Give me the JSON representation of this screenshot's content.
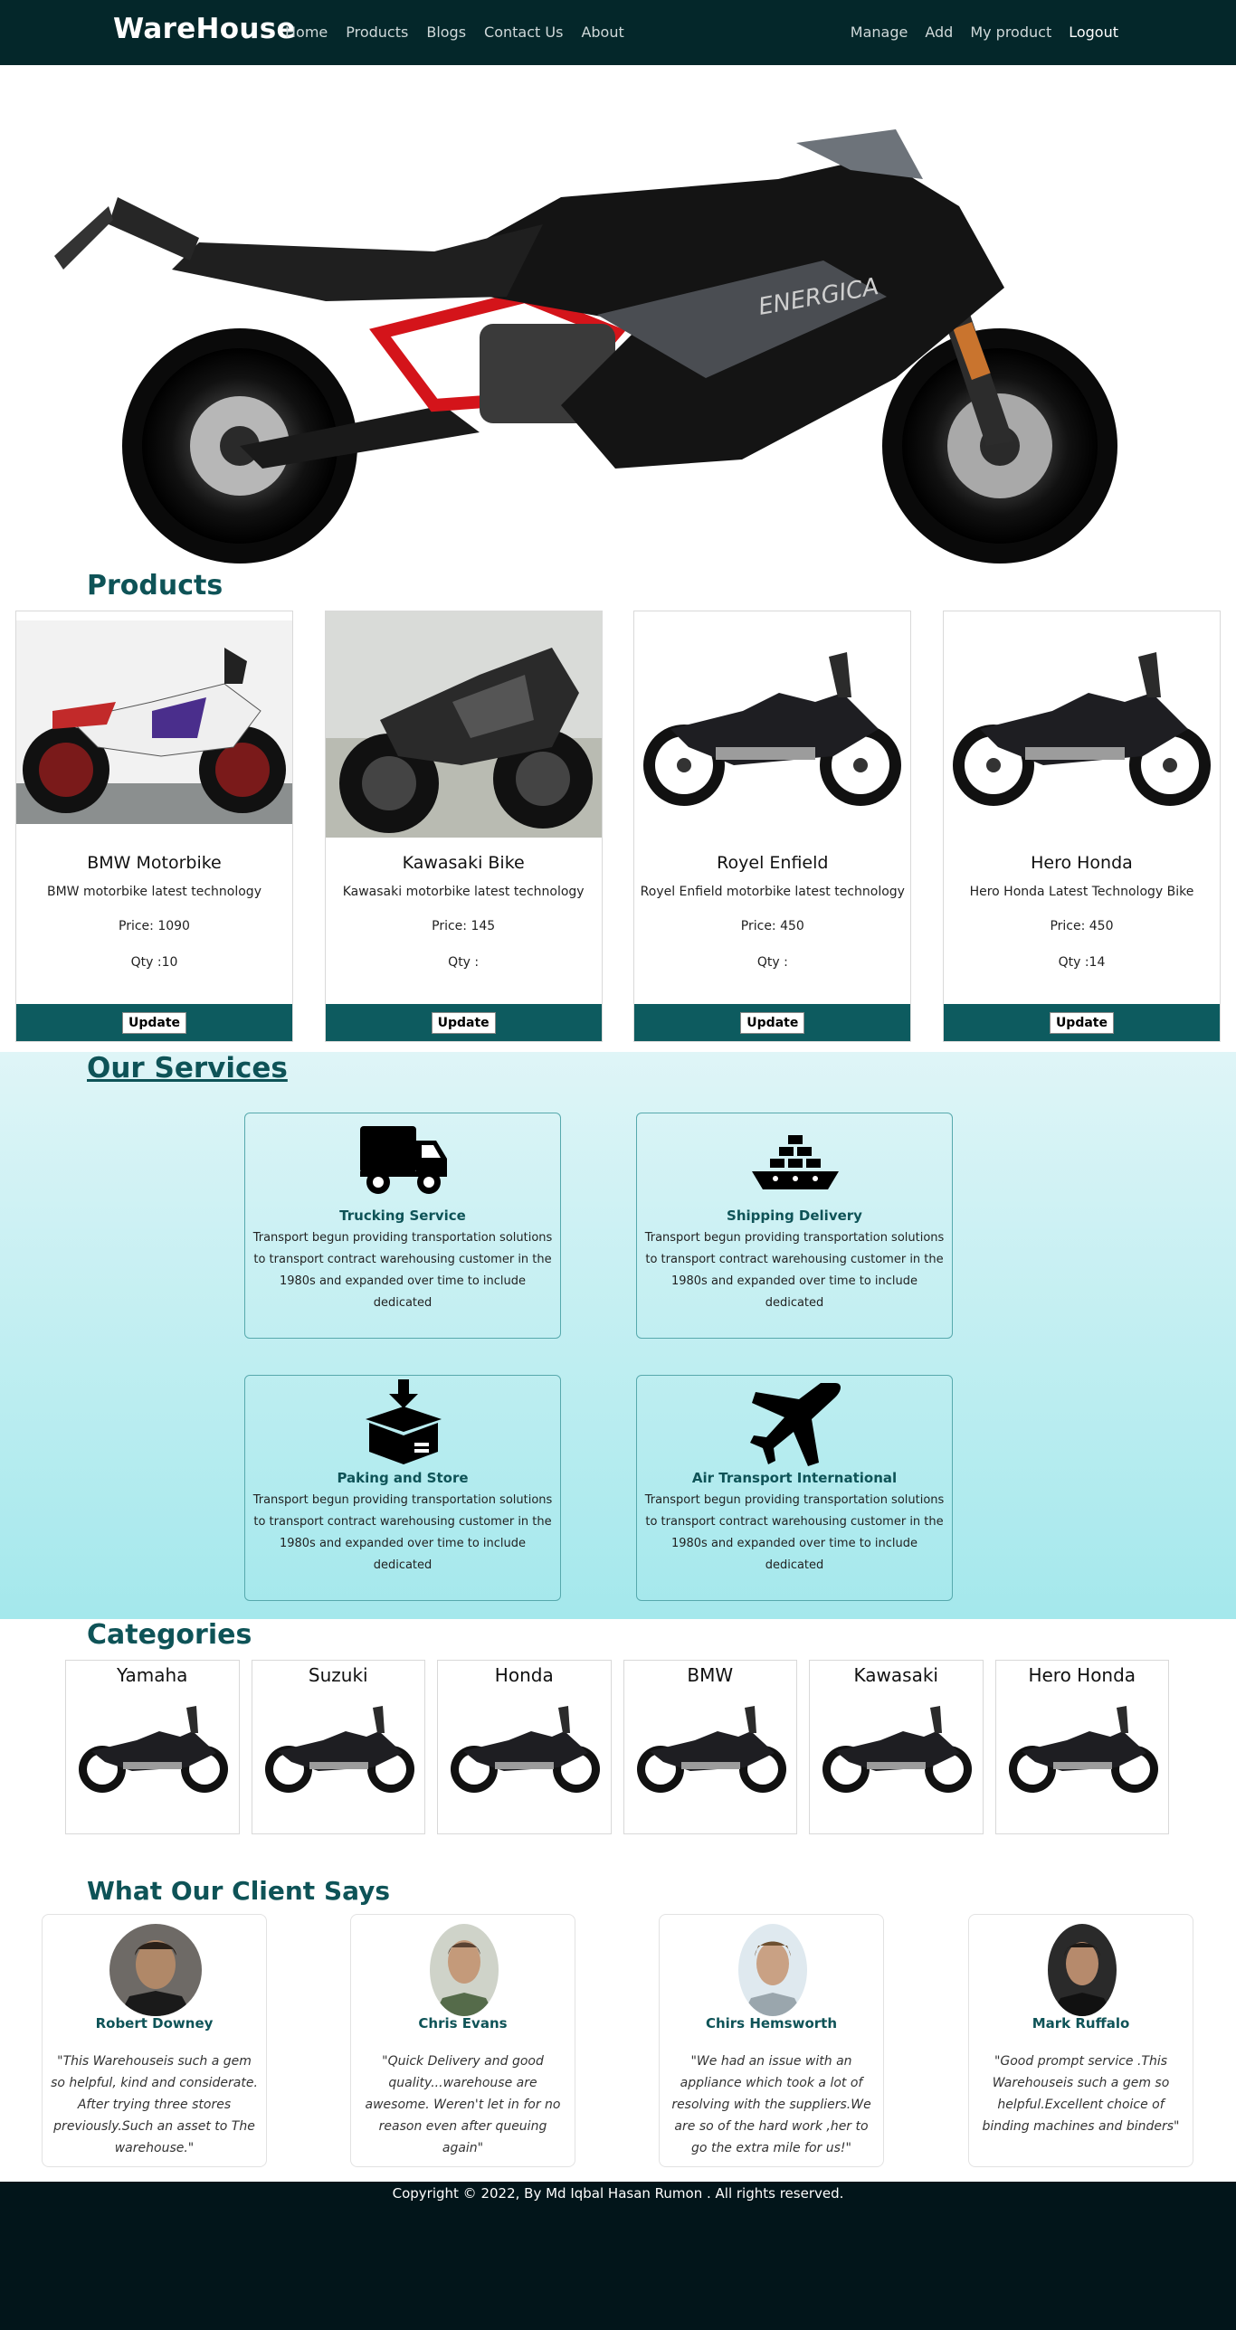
{
  "nav": {
    "brand": "WareHouse",
    "links": [
      "Home",
      "Products",
      "Blogs",
      "Contact Us",
      "About"
    ],
    "right_links": [
      "Manage",
      "Add",
      "My product"
    ],
    "logout": "Logout"
  },
  "products": {
    "title": "Products",
    "items": [
      {
        "name": "BMW Motorbike",
        "desc": "BMW motorbike latest technology",
        "price": "Price: 1090",
        "qty": "Qty :10",
        "button": "Update"
      },
      {
        "name": "Kawasaki Bike",
        "desc": "Kawasaki motorbike latest technology",
        "price": "Price: 145",
        "qty": "Qty :",
        "button": "Update"
      },
      {
        "name": "Royel Enfield",
        "desc": "Royel Enfield motorbike latest technology",
        "price": "Price: 450",
        "qty": "Qty :",
        "button": "Update"
      },
      {
        "name": "Hero Honda",
        "desc": "Hero Honda Latest Technology Bike",
        "price": "Price: 450",
        "qty": "Qty :14",
        "button": "Update"
      }
    ]
  },
  "services": {
    "title": "Our Services",
    "items": [
      {
        "title": "Trucking Service",
        "icon": "truck-icon",
        "desc": "Transport begun providing transportation solutions to transport contract warehousing customer in the 1980s and expanded over time to include dedicated"
      },
      {
        "title": "Shipping Delivery",
        "icon": "ship-icon",
        "desc": "Transport begun providing transportation solutions to transport contract warehousing customer in the 1980s and expanded over time to include dedicated"
      },
      {
        "title": "Paking and Store",
        "icon": "box-icon",
        "desc": "Transport begun providing transportation solutions to transport contract warehousing customer in the 1980s and expanded over time to include dedicated"
      },
      {
        "title": "Air Transport International",
        "icon": "airplane-icon",
        "desc": "Transport begun providing transportation solutions to transport contract warehousing customer in the 1980s and expanded over time to include dedicated"
      }
    ]
  },
  "categories": {
    "title": "Categories",
    "items": [
      "Yamaha",
      "Suzuki",
      "Honda",
      "BMW",
      "Kawasaki",
      "Hero Honda"
    ]
  },
  "testimonials": {
    "title": "What Our Client Says",
    "items": [
      {
        "name": "Robert Downey",
        "text": "\"This Warehouseis such a gem so helpful, kind and considerate. After trying three stores previously.Such an asset to The warehouse.\""
      },
      {
        "name": "Chris Evans",
        "text": "\"Quick Delivery and good quality...warehouse are awesome. Weren't let in for no reason even after queuing again\""
      },
      {
        "name": "Chirs Hemsworth",
        "text": "\"We had an issue with an appliance which took a lot of resolving with the suppliers.We are so of the hard work ,her to go the extra mile for us!\""
      },
      {
        "name": "Mark Ruffalo",
        "text": "\"Good prompt service .This Warehouseis such a gem so helpful.Excellent choice of binding machines and binders\""
      }
    ]
  },
  "footer": {
    "copyright": "Copyright © 2022, By Md Iqbal Hasan Rumon . All rights reserved."
  },
  "colors": {
    "nav_bg": "#04272a",
    "accent": "#0e5357",
    "button_bar": "#0d5b5f",
    "footer_bg": "#02151a"
  }
}
